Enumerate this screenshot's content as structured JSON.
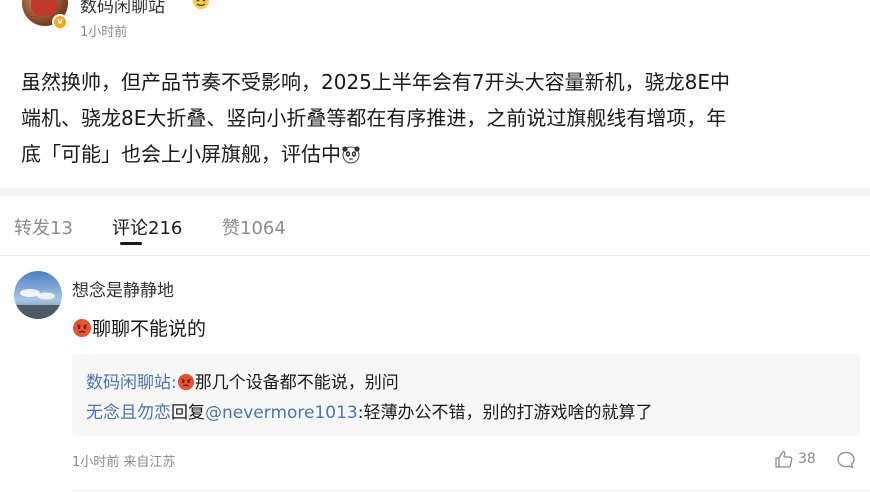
{
  "post": {
    "author_name": "数码闲聊站",
    "time": "1小时前",
    "body_line1": "虽然换帅，但产品节奏不受影响，2025上半年会有7开头大容量新机，骁龙8E中",
    "body_line2": "端机、骁龙8E大折叠、竖向小折叠等都在有序推进，之前说过旗舰线有增项，年",
    "body_line3": "底「可能」也会上小屏旗舰，评估中"
  },
  "tabs": {
    "repost": "转发13",
    "comments": "评论216",
    "likes": "赞1064"
  },
  "comment": {
    "author": "想念是静静地",
    "text": "聊聊不能说的",
    "replies": {
      "r1_author": "数码闲聊站:",
      "r1_text": "那几个设备都不能说，别问",
      "r2_author": "无念且勿恋",
      "r2_mid": "回复",
      "r2_mention": "@nevermore1013",
      "r2_text": ":轻薄办公不错，别的打游戏啥的就算了"
    },
    "meta": "1小时前 来自江苏",
    "like_count": "38"
  },
  "colors": {
    "link_blue": "#4a74b3",
    "muted_text": "#8c8c8c",
    "verified_badge": "#f5a623"
  }
}
